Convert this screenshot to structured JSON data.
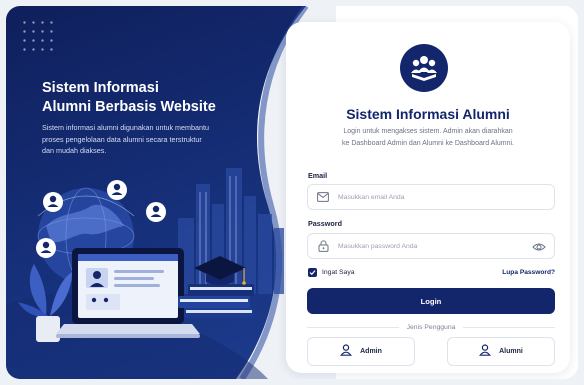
{
  "hero": {
    "title_line1": "Sistem Informasi",
    "title_line2": "Alumni Berbasis Website",
    "description": "Sistem informasi alumni digunakan untuk membantu proses pengelolaan data alumni secara terstruktur dan mudah diakses."
  },
  "card": {
    "title": "Sistem Informasi Alumni",
    "subtitle": "Login untuk mengakses sistem. Admin akan diarahkan ke Dashboard Admin dan Alumni ke Dashboard Alumni."
  },
  "form": {
    "email_label": "Email",
    "email_placeholder": "Masukkan email Anda",
    "password_label": "Password",
    "password_placeholder": "Masukkan password Anda",
    "remember_label": "Ingat Saya",
    "remember_checked": true,
    "forgot_label": "Lupa Password?",
    "login_label": "Login"
  },
  "user_type": {
    "divider_label": "Jenis Pengguna",
    "options": [
      "Admin",
      "Alumni"
    ]
  },
  "colors": {
    "primary": "#13266b",
    "hero_bg": "#16307a",
    "accent_light": "#3d5fc4"
  },
  "icons": [
    "graduates-logo-icon",
    "mail-icon",
    "lock-icon",
    "eye-icon",
    "check-icon",
    "user-icon"
  ]
}
